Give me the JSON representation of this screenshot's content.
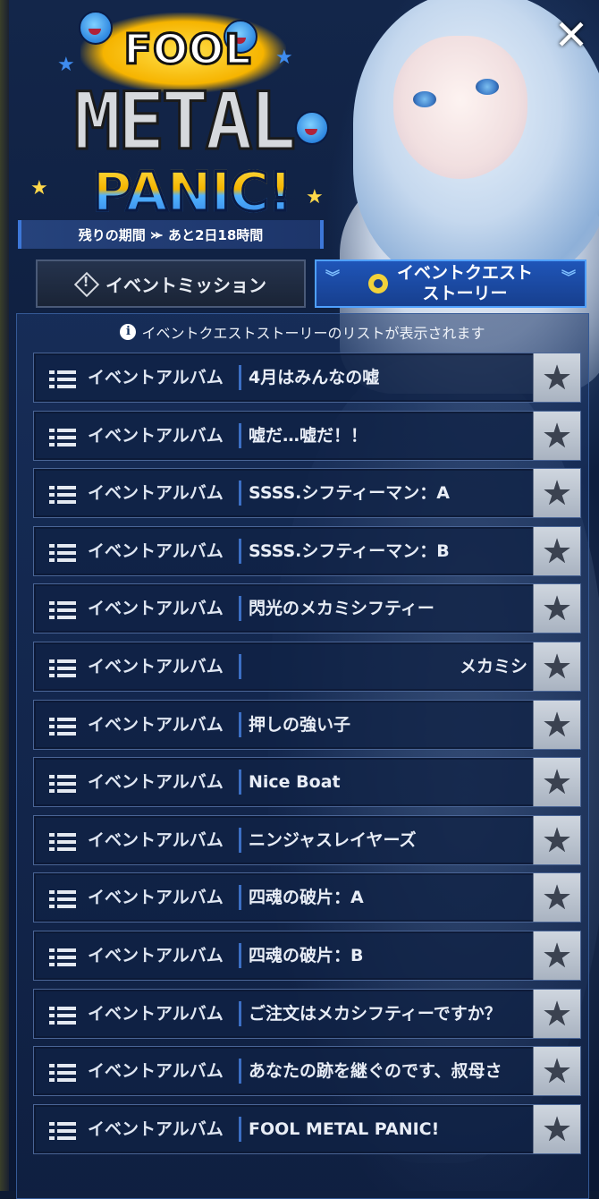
{
  "header": {
    "logo": {
      "line1": "FOOL",
      "line2": "METAL",
      "line3": "PANIC!"
    },
    "period_label": "残りの期間",
    "period_value": "あと2日18時間"
  },
  "close_label": "✕",
  "tabs": [
    {
      "label": "イベントミッション",
      "icon": "warning-diamond-icon",
      "active": false
    },
    {
      "label_line1": "イベントクエスト",
      "label_line2": "ストーリー",
      "icon": "film-reel-icon",
      "active": true
    }
  ],
  "info": {
    "icon": "i",
    "text": "イベントクエストストーリーのリストが表示されます"
  },
  "list": [
    {
      "category": "イベントアルバム",
      "title": "4月はみんなの嘘"
    },
    {
      "category": "イベントアルバム",
      "title": "嘘だ…嘘だ！！"
    },
    {
      "category": "イベントアルバム",
      "title": "SSSS.シフティーマン：A"
    },
    {
      "category": "イベントアルバム",
      "title": "SSSS.シフティーマン：B"
    },
    {
      "category": "イベントアルバム",
      "title": "閃光のメカミシフティー"
    },
    {
      "category": "イベントアルバム",
      "title": "メカミシ"
    },
    {
      "category": "イベントアルバム",
      "title": "押しの強い子"
    },
    {
      "category": "イベントアルバム",
      "title": "Nice Boat"
    },
    {
      "category": "イベントアルバム",
      "title": "ニンジャスレイヤーズ"
    },
    {
      "category": "イベントアルバム",
      "title": "四魂の破片：A"
    },
    {
      "category": "イベントアルバム",
      "title": "四魂の破片：B"
    },
    {
      "category": "イベントアルバム",
      "title": "ご注文はメカシフティーですか？"
    },
    {
      "category": "イベントアルバム",
      "title": "あなたの跡を継ぐのです、叔母さ"
    },
    {
      "category": "イベントアルバム",
      "title": "FOOL METAL PANIC!"
    }
  ],
  "favorite_icon": "star-icon",
  "colors": {
    "accent": "#1f55b8",
    "panel": "#102144",
    "star_bg": "#c3cad5"
  }
}
